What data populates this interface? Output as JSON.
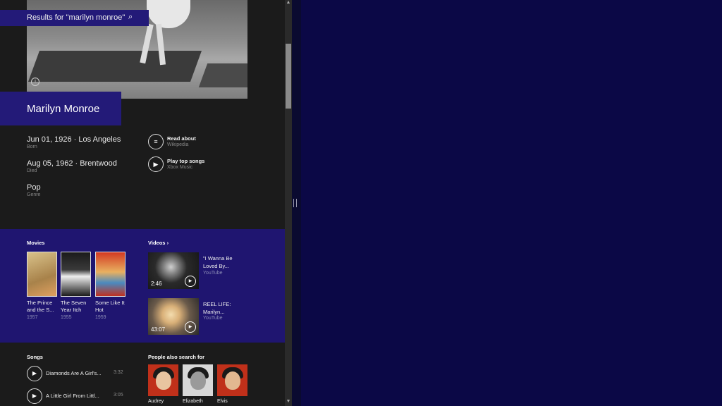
{
  "search": {
    "label": "Results for \"marilyn monroe\""
  },
  "entity": {
    "name": "Marilyn Monroe"
  },
  "facts": [
    {
      "value": "Jun 01, 1926 · Los Angeles",
      "label": "Born"
    },
    {
      "value": "Aug 05, 1962 · Brentwood",
      "label": "Died"
    },
    {
      "value": "Pop",
      "label": "Genre"
    }
  ],
  "actions": [
    {
      "title": "Read about",
      "source": "Wikipedia",
      "icon": "article-icon"
    },
    {
      "title": "Play top songs",
      "source": "Xbox Music",
      "icon": "play-icon"
    }
  ],
  "movies": {
    "heading": "Movies",
    "items": [
      {
        "title": "The Prince and the S...",
        "year": "1957",
        "color": "#c9a85f"
      },
      {
        "title": "The Seven Year Itch",
        "year": "1955",
        "color": "#2a2a2a"
      },
      {
        "title": "Some Like It Hot",
        "year": "1959",
        "color": "#c03020"
      }
    ]
  },
  "videos": {
    "heading": "Videos",
    "items": [
      {
        "title": "\"I Wanna Be Loved By...",
        "source": "YouTube",
        "duration": "2:46"
      },
      {
        "title": "REEL LIFE: Marilyn...",
        "source": "YouTube",
        "duration": "43:07"
      }
    ]
  },
  "songs": {
    "heading": "Songs",
    "items": [
      {
        "title": "Diamonds Are A Girl's...",
        "duration": "3:32"
      },
      {
        "title": "A Little Girl From Littl...",
        "duration": "3:05"
      }
    ]
  },
  "people": {
    "heading": "People also search for",
    "items": [
      {
        "name": "Audrey",
        "color": "#c0301a"
      },
      {
        "name": "Elizabeth",
        "color": "#d8d8d8"
      },
      {
        "name": "Elvis",
        "color": "#c0301a"
      }
    ]
  },
  "theme": {
    "accent": "#231a78",
    "band": "#1f1570",
    "background": "#1b1b1b",
    "right_pane": "#0b0846"
  }
}
